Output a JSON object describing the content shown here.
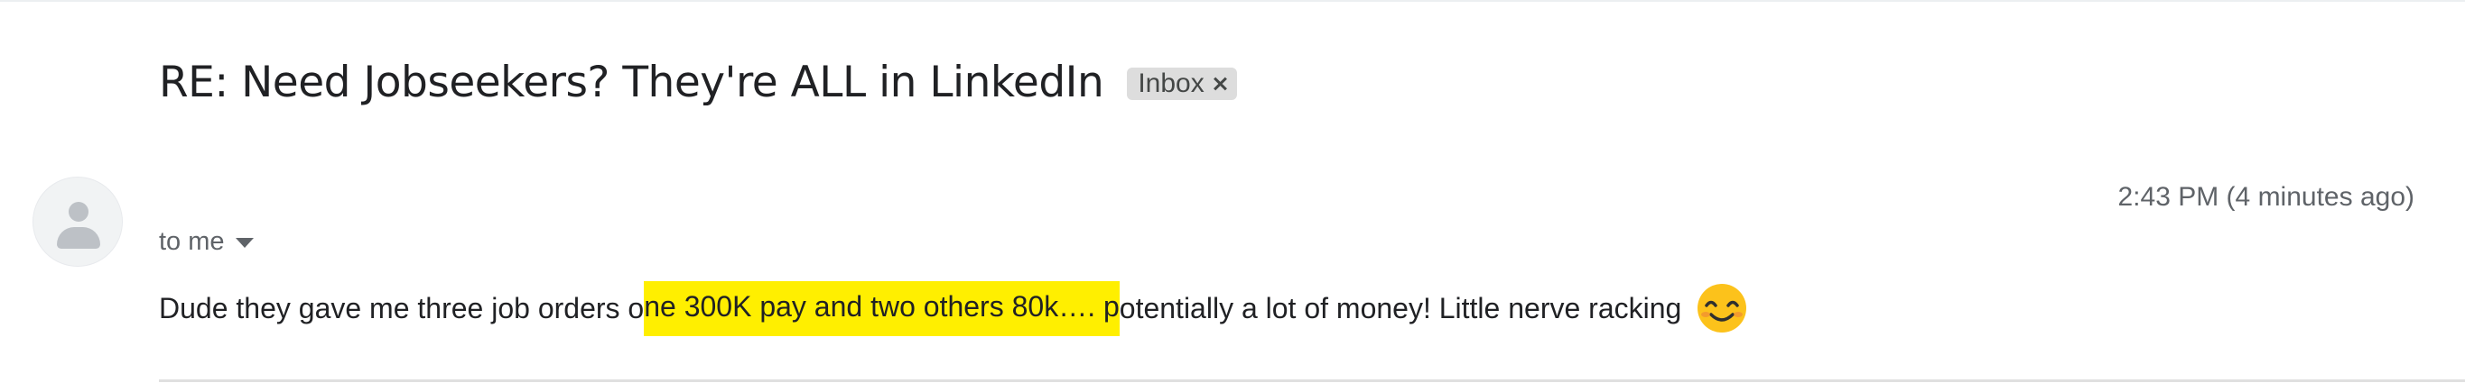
{
  "email": {
    "subject": "RE: Need Jobseekers? They're ALL in LinkedIn",
    "label": "Inbox",
    "timestamp": "2:43 PM (4 minutes ago)",
    "recipient": "to me",
    "body_before": "Dude they gave me three job orders o",
    "body_highlight": "ne 300K pay and two others 80k…. p",
    "body_after": "otentially a lot of money! Little nerve racking",
    "emoji": "smiling-face-emoji"
  },
  "colors": {
    "highlight": "#ffef00",
    "label_chip": "#dddddd",
    "secondary_text": "#5f6368"
  }
}
